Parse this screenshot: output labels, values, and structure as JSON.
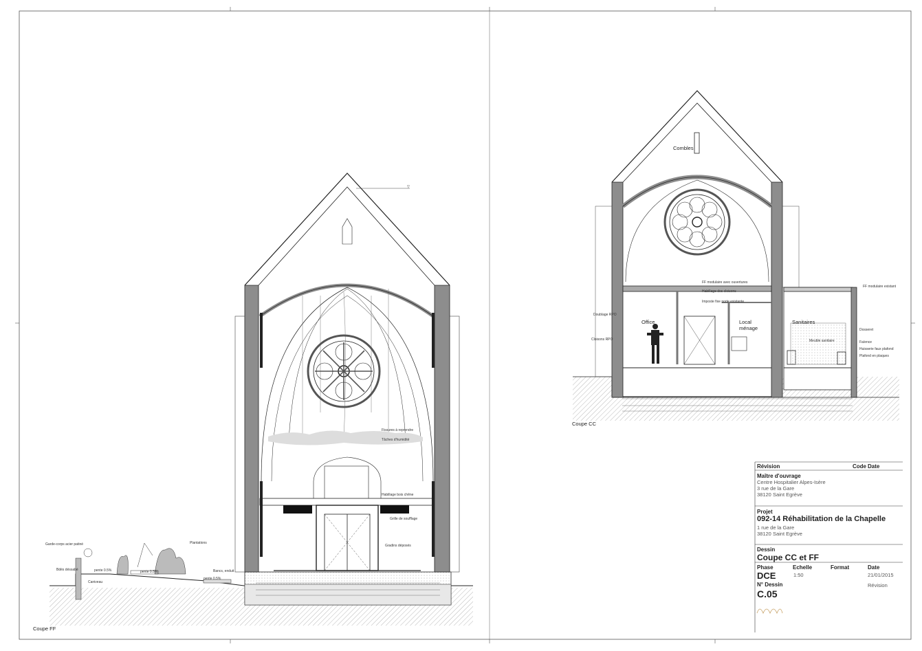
{
  "captions": {
    "coupe_ff": "Coupe FF",
    "coupe_cc": "Coupe CC"
  },
  "rooms": {
    "combles": "Combles",
    "office": "Office",
    "local_menage_1": "Local",
    "local_menage_2": "ménage",
    "sanitaires": "Sanitaires"
  },
  "title_block": {
    "revision_label": "Révision",
    "code_label": "Code",
    "date_label": "Date",
    "maitre_label": "Maître d'ouvrage",
    "maitre_lines": [
      "Centre Hospitalier Alpes-Isère",
      "3 rue de la Gare",
      "38120 Saint Egrève"
    ],
    "projet_label": "Projet",
    "projet_title": "092-14 Réhabilitation de la Chapelle",
    "projet_lines": [
      "1 rue de la Gare",
      "38120 Saint Egrève"
    ],
    "dessin_label": "Dessin",
    "dessin_title": "Coupe CC et FF",
    "phase_label": "Phase",
    "echelle_label": "Echelle",
    "format_label": "Format",
    "date2_label": "Date",
    "phase_value": "DCE",
    "echelle_value": "1:50",
    "date_value": "21/01/2015",
    "revision_value": "Révision",
    "no_dessin_label": "N° Dessin",
    "no_dessin_value": "C.05"
  },
  "annotations_ff": {
    "n1": "Garde-corps acier patiné",
    "n2": "Bdés déssabé",
    "n3": "pente 0.5%",
    "n4": "pente 0.5%",
    "n5": "pente 0.5%",
    "n6": "Caniveau",
    "n7": "Plantations",
    "n8": "Bancs, enduit",
    "n9": "Fissures à reprendre",
    "n10": "Tâches d'humidité",
    "n11": "Habillage bois chêne",
    "n12": "Grille de soufflage",
    "n13": "Gradins déposés"
  },
  "annotations_cc": {
    "m1": "Cloisons RPO",
    "m2": "Doublage RPO",
    "m3": "Meuble sanitaire",
    "m4": "FF modulaire avec ouvertures",
    "m5": "Habillage dos cloisons",
    "m6": "Imposte fixe porte existante",
    "m7": "FF modulaire existant",
    "m8": "Dosseret",
    "m9": "Faïence",
    "m10": "Huisserie faux plafond",
    "m11": "Plafond en plaques"
  },
  "colors": {
    "line": "#222222",
    "wall": "#888888",
    "hatch": "#9a9a9a",
    "ground": "#bdbdbd",
    "background": "#ffffff"
  }
}
